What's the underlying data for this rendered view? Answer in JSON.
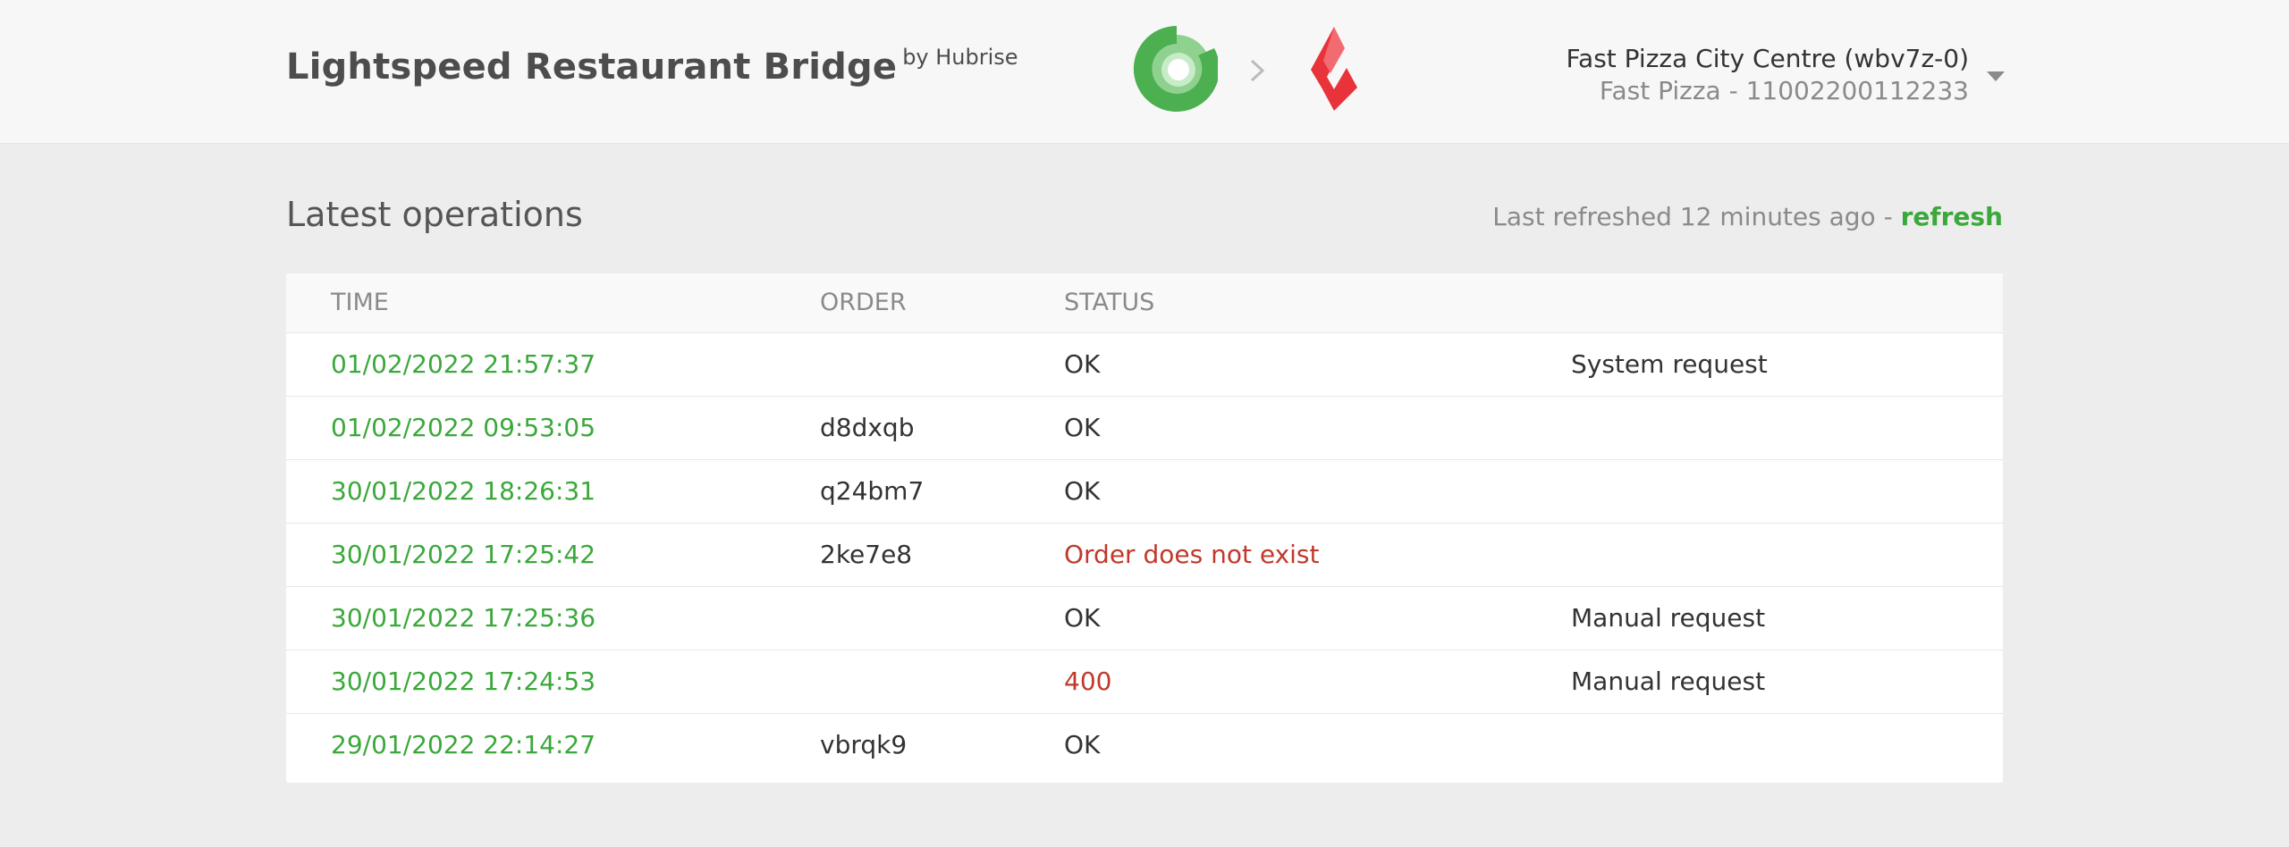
{
  "header": {
    "title": "Lightspeed Restaurant Bridge",
    "by": "by Hubrise",
    "logo_source": "hubrise-logo",
    "logo_target": "lightspeed-logo",
    "account": {
      "name": "Fast Pizza City Centre (wbv7z-0)",
      "sub": "Fast Pizza - 11002200112233"
    }
  },
  "main": {
    "section_title": "Latest operations",
    "refresh": {
      "text": "Last refreshed 12 minutes ago - ",
      "link": "refresh"
    },
    "table": {
      "columns": [
        "TIME",
        "ORDER",
        "STATUS",
        ""
      ],
      "rows": [
        {
          "time": "01/02/2022 21:57:37",
          "order": "",
          "status": "OK",
          "note": "System request",
          "error": false
        },
        {
          "time": "01/02/2022 09:53:05",
          "order": "d8dxqb",
          "status": "OK",
          "note": "",
          "error": false
        },
        {
          "time": "30/01/2022 18:26:31",
          "order": "q24bm7",
          "status": "OK",
          "note": "",
          "error": false
        },
        {
          "time": "30/01/2022 17:25:42",
          "order": "2ke7e8",
          "status": "Order does not exist",
          "note": "",
          "error": true
        },
        {
          "time": "30/01/2022 17:25:36",
          "order": "",
          "status": "OK",
          "note": "Manual request",
          "error": false
        },
        {
          "time": "30/01/2022 17:24:53",
          "order": "",
          "status": "400",
          "note": "Manual request",
          "error": true
        },
        {
          "time": "29/01/2022 22:14:27",
          "order": "vbrqk9",
          "status": "OK",
          "note": "",
          "error": false
        }
      ]
    }
  },
  "colors": {
    "accent_green": "#3aa83a",
    "error_red": "#c0392b",
    "lightspeed_red": "#e8333a",
    "hubrise_green": "#4caf50"
  }
}
